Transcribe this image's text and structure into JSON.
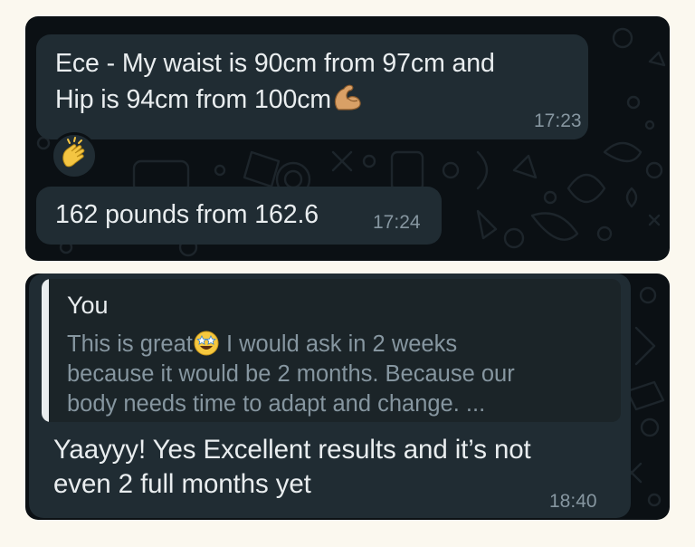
{
  "chat_top": {
    "message_1": {
      "text_line1": "Ece - My waist is 90cm from 97cm and",
      "text_line2": "Hip is 94cm from 100cm",
      "emoji": "flexed-biceps",
      "time": "17:23",
      "reaction_emoji": "clapping-hands"
    },
    "message_2": {
      "text": "162 pounds from 162.6",
      "time": "17:24"
    }
  },
  "chat_bottom": {
    "reply": {
      "quoted_author": "You",
      "quoted_text_part1": "This is great",
      "quoted_emoji": "star-struck",
      "quoted_text_part2": " I would ask in 2 weeks",
      "quoted_text_line2": "because it would be 2 months. Because our",
      "quoted_text_line3": "body needs time to adapt and change. ...",
      "text_line1": "Yaayyy! Yes Excellent results and it’s not",
      "text_line2": "even 2 full months yet",
      "time": "18:40"
    }
  },
  "colors": {
    "page_background": "#fbf8ef",
    "chat_background": "#0b1014",
    "bubble_background": "#202c33",
    "quote_background": "#1b2428",
    "text_primary": "#e9edef",
    "text_secondary": "#8696a0"
  }
}
